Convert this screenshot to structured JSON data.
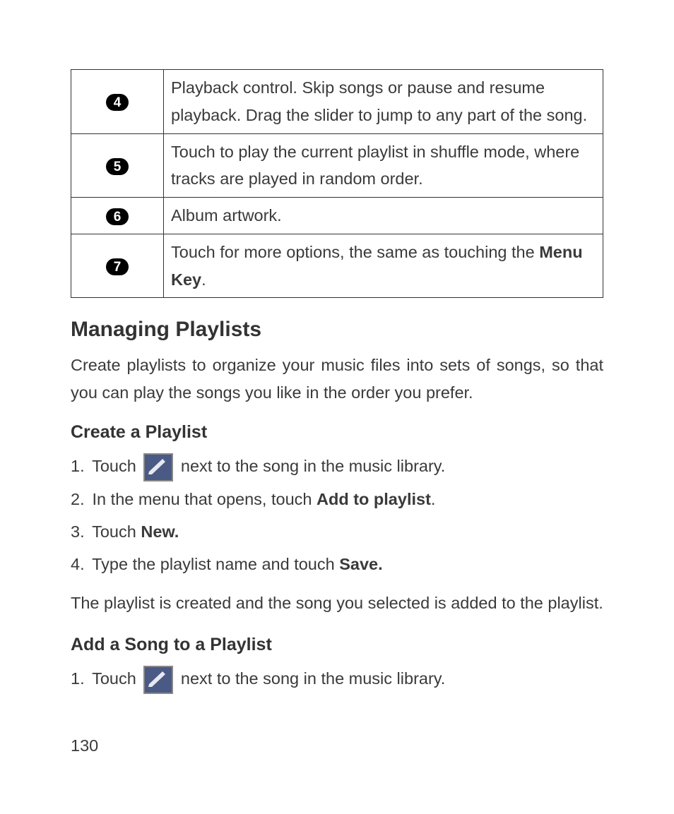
{
  "table": {
    "rows": [
      {
        "num": "4",
        "desc": "Playback control. Skip songs or pause and resume playback. Drag the slider to jump to any part of the song."
      },
      {
        "num": "5",
        "desc": "Touch to play the current playlist in shuffle mode, where tracks are played in random order."
      },
      {
        "num": "6",
        "desc": "Album artwork."
      },
      {
        "num": "7",
        "desc_prefix": "Touch for more options, the same as touching the ",
        "desc_bold": "Menu Key",
        "desc_suffix": "."
      }
    ]
  },
  "section_title": "Managing Playlists",
  "section_body": "Create playlists to organize your music files into sets of songs, so that you can play the songs you like in the order you prefer.",
  "sub1_title": "Create a Playlist",
  "sub1_steps": {
    "s1_num": "1.",
    "s1_pre": "Touch ",
    "s1_post": " next to the song in the music library.",
    "s2_num": "2.",
    "s2_pre": "In the menu that opens, touch ",
    "s2_bold": "Add to playlist",
    "s2_post": ".",
    "s3_num": "3.",
    "s3_pre": "Touch ",
    "s3_bold": "New.",
    "s4_num": "4.",
    "s4_pre": "Type the playlist name and touch ",
    "s4_bold": "Save."
  },
  "sub1_after": "The playlist is created and the song you selected is added to the playlist.",
  "sub2_title": "Add a Song to a Playlist",
  "sub2_steps": {
    "s1_num": "1.",
    "s1_pre": "Touch ",
    "s1_post": " next to the song in the music library."
  },
  "page_number": "130"
}
